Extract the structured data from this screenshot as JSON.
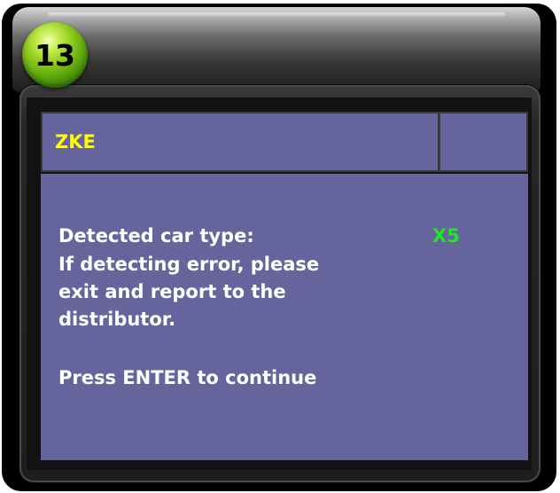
{
  "step": {
    "number": "13"
  },
  "header": {
    "title": "ZKE",
    "side_text": ""
  },
  "message": {
    "detected_label": "Detected car type:",
    "car_type": "X5",
    "error_line_1": "If detecting error, please",
    "error_line_2": "exit and report to the",
    "error_line_3": "distributor.",
    "continue_prompt": "Press ENTER to continue"
  },
  "colors": {
    "panel_background": "#65649c",
    "header_title": "#ffff00",
    "car_type_value": "#22e522",
    "message_text": "#ffffff",
    "badge": "#7fc21a"
  }
}
